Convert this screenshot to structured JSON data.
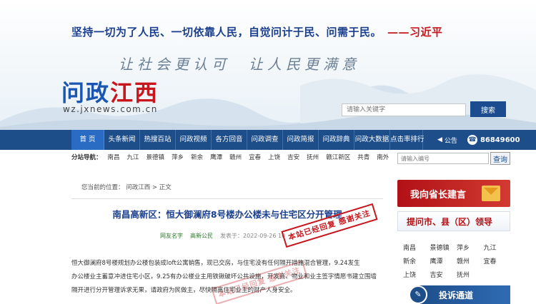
{
  "header": {
    "motto": "坚持一切为了人民、一切依靠人民，自觉问计于民、问需于民。",
    "motto_author": "——习近平",
    "slogan_left": "让社会更认可",
    "slogan_right": "让人民更满意",
    "logo_part1": "问政",
    "logo_part2": "江西",
    "url": "wz.jxnews.com.cn",
    "search_placeholder": "请输入关键字",
    "search_button": "搜索"
  },
  "nav": {
    "items": [
      {
        "label": "首 页",
        "active": true
      },
      {
        "label": "头条新闻"
      },
      {
        "label": "热搜百站"
      },
      {
        "label": "问政视频"
      },
      {
        "label": "各方回音"
      },
      {
        "label": "问政调查"
      },
      {
        "label": "问政简报"
      },
      {
        "label": "问政辞典"
      },
      {
        "label": "问政大数据"
      },
      {
        "label": "点击率排行"
      }
    ],
    "notice": "公告",
    "phone": "86849600"
  },
  "subnav": {
    "label": "分站导航：",
    "cities": [
      "南昌",
      "九江",
      "景德镇",
      "萍乡",
      "新余",
      "鹰潭",
      "赣州",
      "宜春",
      "上饶",
      "吉安",
      "抚州",
      "赣江新区",
      "共青",
      "南外"
    ]
  },
  "side_search": {
    "placeholder": "请输入编号",
    "button": "查询"
  },
  "article": {
    "breadcrumb": "您当前的位置：  问政江西  >  正文",
    "title": "南昌高新区：恒大御澜府8号楼办公楼未与住宅区分开管理",
    "user": "网友名字",
    "dept": "高新公民",
    "time": "发表于：2022-09-26 10",
    "stamp": "本站已经回复 感谢关注",
    "body": [
      "恒大御澜府8号楼规划办公楼包装成loft公寓销售，现已交房，与住宅没有任何隔开措施混合管理，9.24发生",
      "办公楼业主蓄意冲进住宅小区，9.25有办公楼业主用铁锹破坏公共设施，开发商、物业和业主签字情愿书建立围墙",
      "隔开进行分开管理诉求无果，请政府为民做主，尽快隔离住宅业主的财产人身安全。"
    ]
  },
  "sidebar": {
    "gov_banner": "我向省长建言",
    "county_header": "提问市、县（区）领导",
    "counties": [
      "南昌",
      "景德镇",
      "萍乡",
      "九江",
      "新余",
      "鹰潭",
      "赣州",
      "宜春",
      "上饶",
      "吉安",
      "抚州"
    ],
    "complain": "投诉通道"
  }
}
